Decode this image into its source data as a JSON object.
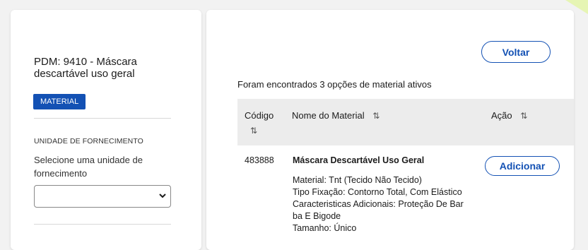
{
  "pdm": {
    "title": "PDM: 9410 - Máscara descartável uso geral",
    "badge": "MATERIAL"
  },
  "fornecimento": {
    "label": "UNIDADE DE FORNECIMENTO",
    "help": "Selecione uma unidade de fornecimento",
    "selected": ""
  },
  "main": {
    "back_label": "Voltar",
    "results_text": "Foram encontrados 3 opções de material ativos",
    "columns": {
      "code": "Código",
      "name": "Nome do Material",
      "action": "Ação"
    },
    "sort_icon": "⇅",
    "rows": [
      {
        "code": "483888",
        "name": "Máscara Descartável Uso Geral",
        "details": [
          "Material: Tnt (Tecido Não Tecido)",
          "Tipo Fixação: Contorno Total, Com Elástico",
          "Caracteristicas Adicionais: Proteção De Bar",
          "ba E Bigode",
          "Tamanho: Único"
        ],
        "action_label": "Adicionar"
      }
    ]
  },
  "colors": {
    "primary": "#1351b4",
    "header_bg": "#ececec",
    "page_bg": "#f2f2f2"
  }
}
